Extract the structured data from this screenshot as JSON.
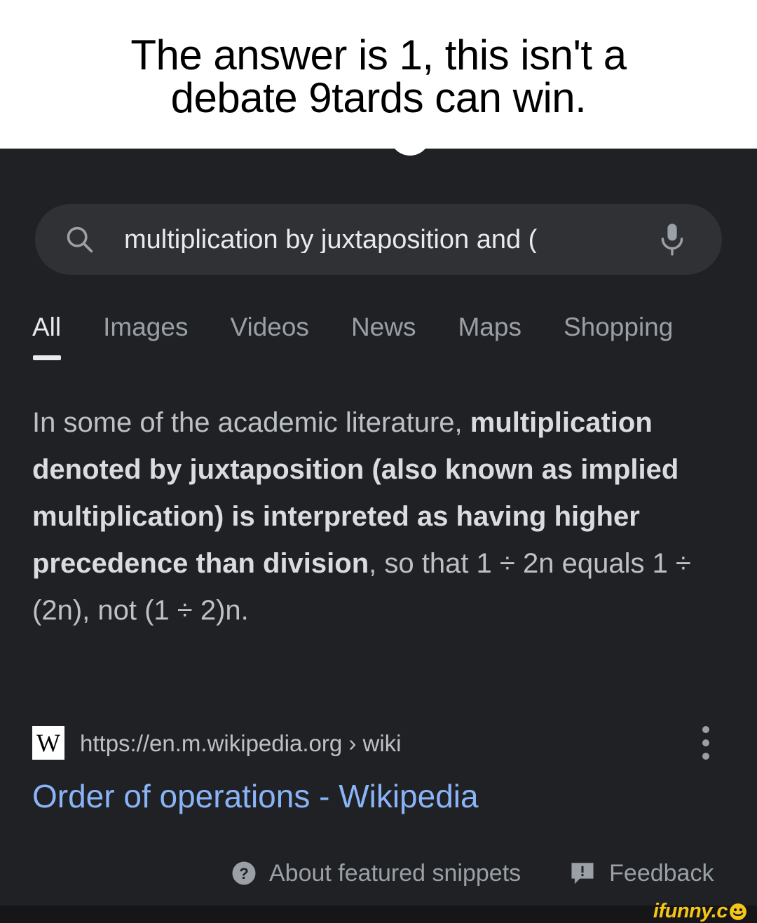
{
  "caption": {
    "line1": "The answer is 1, this isn't a",
    "line2": "debate 9tards can win."
  },
  "search": {
    "icon": "search-icon",
    "value": "multiplication by juxtaposition and (",
    "mic_icon": "microphone-icon"
  },
  "tabs": [
    {
      "label": "All",
      "active": true
    },
    {
      "label": "Images",
      "active": false
    },
    {
      "label": "Videos",
      "active": false
    },
    {
      "label": "News",
      "active": false
    },
    {
      "label": "Maps",
      "active": false
    },
    {
      "label": "Shopping",
      "active": false
    }
  ],
  "snippet": {
    "text_part1": "In some of the academic literature, ",
    "bold_part": "multiplication denoted by juxtaposition (also known as implied multiplication) is interpreted as having higher precedence than division",
    "text_part2": ", so that 1 ÷ 2n equals 1 ÷ (2n), not (1 ÷ 2)n."
  },
  "source": {
    "favicon_letter": "W",
    "favicon_icon": "wikipedia-favicon",
    "url": "https://en.m.wikipedia.org › wiki",
    "menu_icon": "kebab-menu-icon"
  },
  "result": {
    "title": "Order of operations - Wikipedia"
  },
  "footer": {
    "about_icon": "help-circle-icon",
    "about_label": "About featured snippets",
    "feedback_icon": "feedback-icon",
    "feedback_label": "Feedback"
  },
  "watermark": {
    "text": "ifunny.c",
    "smiley_icon": "smiley-face-icon"
  },
  "colors": {
    "page_background": "#202124",
    "search_pill": "#303134",
    "link_blue": "#8ab4f8",
    "body_text": "#bdc1c6",
    "bold_text": "#dadce0",
    "muted_text": "#9aa0a6",
    "bottom_bar": "#161618",
    "watermark": "#f5c518"
  }
}
